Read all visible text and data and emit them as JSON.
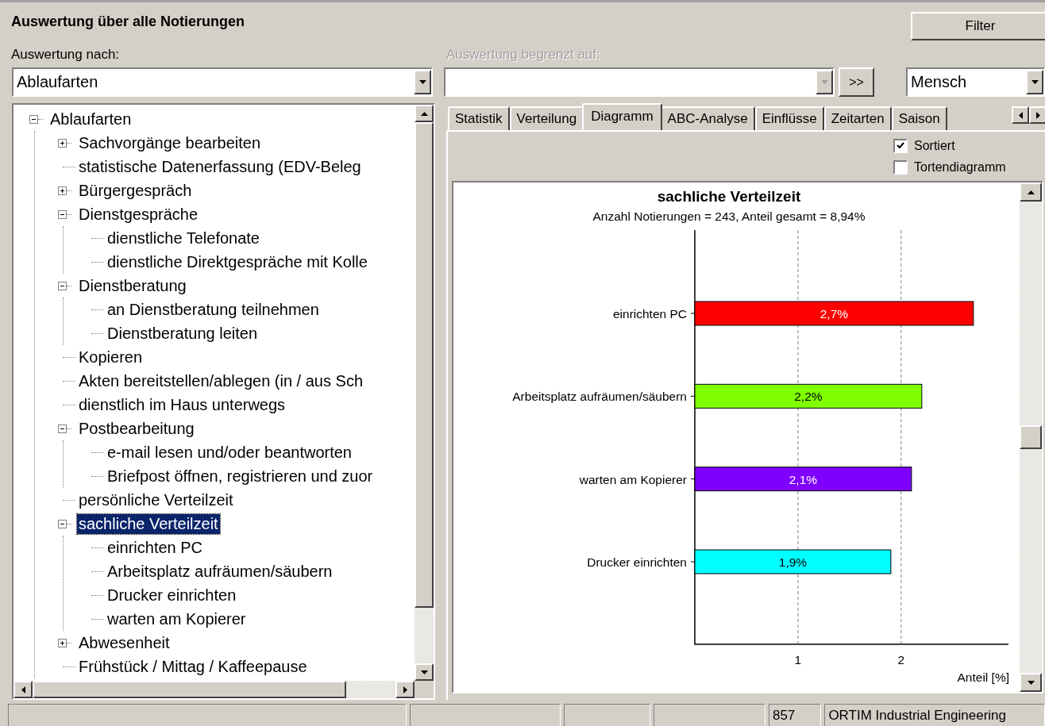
{
  "title": "Auswertung über alle Notierungen",
  "filter_button": "Filter",
  "evaluation_by": {
    "label": "Auswertung nach:",
    "value": "Ablaufarten"
  },
  "limited_to": {
    "label": "Auswertung begrenzt auf:",
    "disabled": true,
    "apply_button": ">>"
  },
  "subject": {
    "value": "Mensch"
  },
  "tree": [
    {
      "label": "Ablaufarten",
      "expanded": true,
      "selected": false,
      "children": [
        {
          "label": "Sachvorgänge bearbeiten",
          "expanded": false,
          "selected": false
        },
        {
          "label": "statistische Datenerfassung (EDV-Beleg",
          "selected": false
        },
        {
          "label": "Bürgergespräch",
          "expanded": false,
          "selected": false
        },
        {
          "label": "Dienstgespräche",
          "expanded": true,
          "selected": false,
          "children": [
            {
              "label": "dienstliche Telefonate",
              "selected": false
            },
            {
              "label": "dienstliche Direktgespräche mit Kolle",
              "selected": false
            }
          ]
        },
        {
          "label": "Dienstberatung",
          "expanded": true,
          "selected": false,
          "children": [
            {
              "label": "an Dienstberatung teilnehmen",
              "selected": false
            },
            {
              "label": "Dienstberatung leiten",
              "selected": false
            }
          ]
        },
        {
          "label": "Kopieren",
          "selected": false
        },
        {
          "label": "Akten bereitstellen/ablegen (in / aus Sch",
          "selected": false
        },
        {
          "label": "dienstlich im Haus unterwegs",
          "selected": false
        },
        {
          "label": "Postbearbeitung",
          "expanded": true,
          "selected": false,
          "children": [
            {
              "label": "e-mail lesen und/oder beantworten",
              "selected": false
            },
            {
              "label": "Briefpost öffnen, registrieren und zuor",
              "selected": false
            }
          ]
        },
        {
          "label": "persönliche Verteilzeit",
          "selected": false
        },
        {
          "label": "sachliche Verteilzeit",
          "expanded": true,
          "selected": true,
          "children": [
            {
              "label": "einrichten PC",
              "selected": false
            },
            {
              "label": "Arbeitsplatz aufräumen/säubern",
              "selected": false
            },
            {
              "label": "Drucker einrichten",
              "selected": false
            },
            {
              "label": "warten am Kopierer",
              "selected": false
            }
          ]
        },
        {
          "label": "Abwesenheit",
          "expanded": false,
          "selected": false
        },
        {
          "label": "Frühstück / Mittag / Kaffeepause",
          "selected": false
        }
      ]
    }
  ],
  "tabs": [
    {
      "label": "Statistik",
      "selected": false
    },
    {
      "label": "Verteilung",
      "selected": false
    },
    {
      "label": "Diagramm",
      "selected": true
    },
    {
      "label": "ABC-Analyse",
      "selected": false
    },
    {
      "label": "Einflüsse",
      "selected": false
    },
    {
      "label": "Zeitarten",
      "selected": false
    },
    {
      "label": "Saison",
      "selected": false
    }
  ],
  "options": [
    {
      "label": "Sortiert",
      "checked": true
    },
    {
      "label": "Tortendiagramm",
      "checked": false
    }
  ],
  "chart": {
    "chart_data": {
      "type": "bar",
      "orientation": "horizontal",
      "title": "sachliche Verteilzeit",
      "subtitle": "Anzahl Notierungen = 243, Anteil gesamt = 8,94%",
      "xlabel": "Anteil [%]",
      "categories": [
        "einrichten PC",
        "Arbeitsplatz aufräumen/säubern",
        "warten am Kopierer",
        "Drucker einrichten"
      ],
      "values": [
        2.7,
        2.2,
        2.1,
        1.9
      ],
      "colors": [
        "#ff0000",
        "#80ff00",
        "#8000ff",
        "#00ffff"
      ],
      "value_labels": [
        "2,7%",
        "2,2%",
        "2,1%",
        "1,9%"
      ],
      "xlim": [
        0,
        3.04
      ],
      "xticks": [
        1,
        2
      ]
    }
  },
  "status_bar": {
    "count": "857",
    "company": "ORTIM Industrial Engineering"
  }
}
